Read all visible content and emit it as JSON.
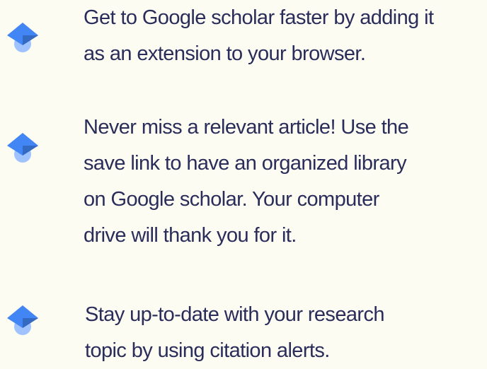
{
  "tips": [
    {
      "icon": "google-scholar-icon",
      "lines": [
        "Get to Google scholar faster by adding it",
        "as an extension to your browser."
      ]
    },
    {
      "icon": "google-scholar-icon",
      "lines": [
        "Never miss a relevant article! Use the",
        "save link to have an organized library",
        "on Google scholar. Your computer",
        "drive will thank you for it."
      ]
    },
    {
      "icon": "google-scholar-icon",
      "lines": [
        "Stay up-to-date with your research",
        "topic by using citation alerts."
      ]
    }
  ],
  "colors": {
    "background": "#fdfcf3",
    "text": "#2a2d5a",
    "icon_cap": "#4285f4",
    "icon_cap_dark": "#356ac3",
    "icon_head": "#a0c3ff"
  }
}
